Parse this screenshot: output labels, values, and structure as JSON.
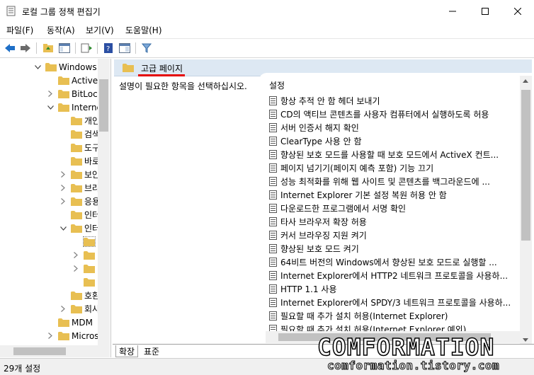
{
  "window": {
    "title": "로컬 그룹 정책 편집기"
  },
  "menu": [
    "파일(F)",
    "동작(A)",
    "보기(V)",
    "도움말(H)"
  ],
  "tree": {
    "items": [
      {
        "label": "Windows",
        "level": 0,
        "twisty": "expanded"
      },
      {
        "label": "ActiveX",
        "level": 1,
        "twisty": "none"
      },
      {
        "label": "BitLock",
        "level": 1,
        "twisty": "collapsed"
      },
      {
        "label": "Interne",
        "level": 1,
        "twisty": "expanded"
      },
      {
        "label": "개인",
        "level": 2,
        "twisty": "none"
      },
      {
        "label": "검색",
        "level": 2,
        "twisty": "none"
      },
      {
        "label": "도구",
        "level": 2,
        "twisty": "none"
      },
      {
        "label": "바로",
        "level": 2,
        "twisty": "none"
      },
      {
        "label": "보안",
        "level": 2,
        "twisty": "collapsed"
      },
      {
        "label": "브라",
        "level": 2,
        "twisty": "collapsed"
      },
      {
        "label": "응용",
        "level": 2,
        "twisty": "collapsed"
      },
      {
        "label": "인터",
        "level": 2,
        "twisty": "none"
      },
      {
        "label": "인터",
        "level": 2,
        "twisty": "expanded"
      },
      {
        "label": "",
        "level": 3,
        "twisty": "none",
        "selected": true
      },
      {
        "label": "",
        "level": 3,
        "twisty": "collapsed"
      },
      {
        "label": "",
        "level": 3,
        "twisty": "collapsed"
      },
      {
        "label": "",
        "level": 3,
        "twisty": "none"
      },
      {
        "label": "호환",
        "level": 2,
        "twisty": "none"
      },
      {
        "label": "회사",
        "level": 2,
        "twisty": "collapsed"
      },
      {
        "label": "MDM",
        "level": 1,
        "twisty": "none"
      },
      {
        "label": "Micros",
        "level": 1,
        "twisty": "collapsed"
      },
      {
        "label": "Micros",
        "level": 1,
        "twisty": "collapsed"
      },
      {
        "label": "Micros",
        "level": 1,
        "twisty": "collapsed"
      }
    ]
  },
  "right": {
    "header_title": "고급 페이지",
    "description": "설명이 필요한 항목을 선택하십시오.",
    "column_header": "설정",
    "settings": [
      "항상 추적 안 함 헤더 보내기",
      "CD의 액티브 콘텐츠를 사용자 컴퓨터에서 실행하도록 허용",
      "서버 인증서 해지 확인",
      "ClearType 사용 안 함",
      "향상된 보호 모드를 사용할 때 보호 모드에서 ActiveX 컨트...",
      "페이지 넘기기(페이지 예측 포함) 기능 끄기",
      "성능 최적화를 위해 웹 사이트 및 콘텐츠를 백그라운드에 ...",
      "Internet Explorer 기본 설정 복원 허용 안 함",
      "다운로드한 프로그램에서 서명 확인",
      "타사 브라우저 확장 허용",
      "커서 브라우징 지원 켜기",
      "향상된 보호 모드 켜기",
      "64비트 버전의 Windows에서 향상된 보호 모드로 실행할 ...",
      "Internet Explorer에서 HTTP2 네트워크 프로토콜을 사용하...",
      "HTTP 1.1 사용",
      "Internet Explorer에서 SPDY/3 네트워크 프로토콜을 사용하...",
      "필요할 때 추가 설치 허용(Internet Explorer)",
      "필요할 때 추가 설치 허용(Internet Explorer 예외)"
    ]
  },
  "tabs": [
    "확장",
    "표준"
  ],
  "status": "29개 설정",
  "watermark": {
    "big": "COMFORMATION",
    "small": "comformation.tistory.com"
  },
  "colors": {
    "accent_red": "#e50000",
    "header_bg": "#dde8f3",
    "folder": "#e8bf52"
  }
}
